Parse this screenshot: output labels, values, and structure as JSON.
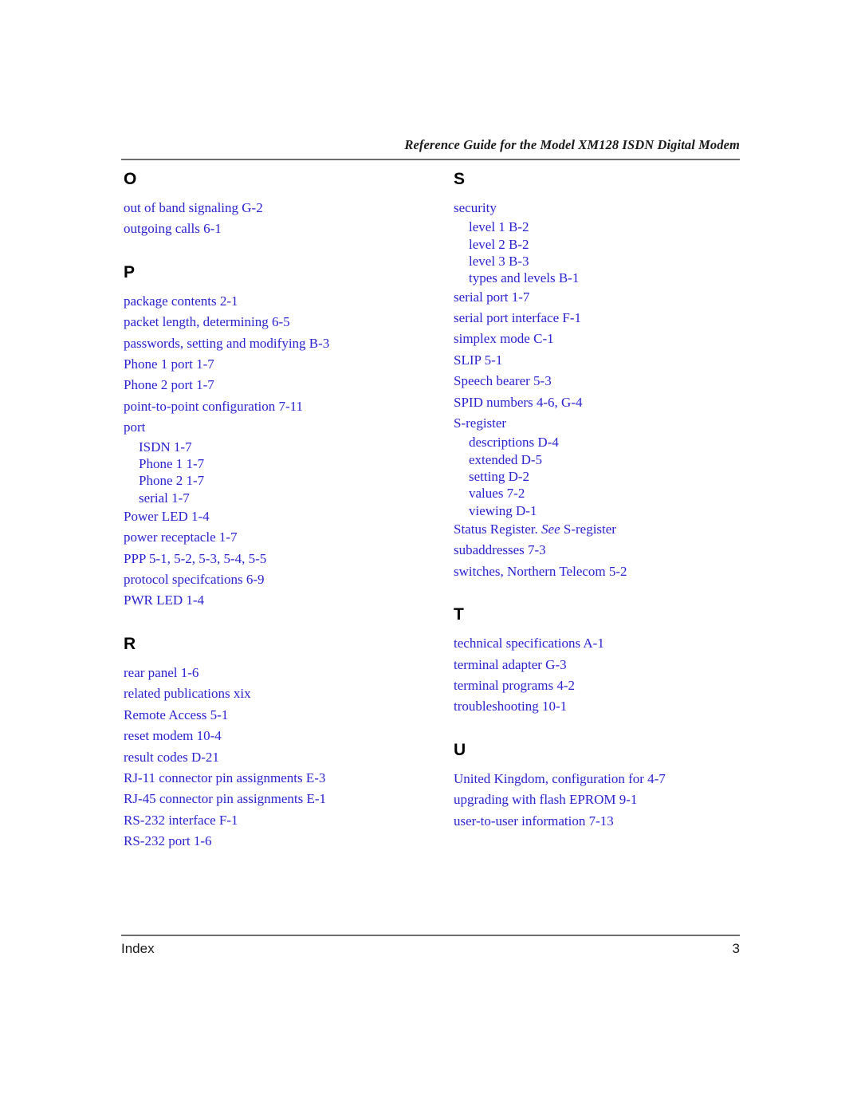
{
  "header": {
    "title": "Reference Guide for the Model XM128 ISDN Digital Modem"
  },
  "footer": {
    "label": "Index",
    "page_number": "3"
  },
  "colors": {
    "entry_blue": "#2a23cf",
    "heading_black": "#000000",
    "rule_gray": "#6e6e6e"
  },
  "columns": [
    {
      "name": "left-column",
      "sections": [
        {
          "letter": "O",
          "entries": [
            {
              "text": "out of band signaling  G-2",
              "level": "main"
            },
            {
              "text": "outgoing calls  6-1",
              "level": "main"
            }
          ]
        },
        {
          "letter": "P",
          "entries": [
            {
              "text": "package contents  2-1",
              "level": "main"
            },
            {
              "text": "packet length, determining  6-5",
              "level": "main"
            },
            {
              "text": "passwords, setting and modifying  B-3",
              "level": "main"
            },
            {
              "text": "Phone 1 port  1-7",
              "level": "main"
            },
            {
              "text": "Phone 2 port  1-7",
              "level": "main"
            },
            {
              "text": "point-to-point configuration  7-11",
              "level": "main"
            },
            {
              "text": "port",
              "level": "main"
            },
            {
              "text": "ISDN  1-7",
              "level": "sub"
            },
            {
              "text": "Phone 1  1-7",
              "level": "sub"
            },
            {
              "text": "Phone 2  1-7",
              "level": "sub"
            },
            {
              "text": "serial  1-7",
              "level": "sub"
            },
            {
              "text": "Power LED  1-4",
              "level": "main"
            },
            {
              "text": "power receptacle  1-7",
              "level": "main"
            },
            {
              "text": "PPP  5-1, 5-2, 5-3, 5-4, 5-5",
              "level": "main"
            },
            {
              "text": "protocol specifcations  6-9",
              "level": "main"
            },
            {
              "text": "PWR LED  1-4",
              "level": "main"
            }
          ]
        },
        {
          "letter": "R",
          "entries": [
            {
              "text": "rear panel  1-6",
              "level": "main"
            },
            {
              "text": "related publications  xix",
              "level": "main"
            },
            {
              "text": "Remote Access  5-1",
              "level": "main"
            },
            {
              "text": "reset modem  10-4",
              "level": "main"
            },
            {
              "text": "result codes  D-21",
              "level": "main"
            },
            {
              "text": "RJ-11 connector pin assignments  E-3",
              "level": "main"
            },
            {
              "text": "RJ-45 connector pin assignments  E-1",
              "level": "main"
            },
            {
              "text": "RS-232 interface  F-1",
              "level": "main"
            },
            {
              "text": "RS-232 port  1-6",
              "level": "main"
            }
          ]
        }
      ]
    },
    {
      "name": "right-column",
      "sections": [
        {
          "letter": "S",
          "entries": [
            {
              "text": "security",
              "level": "main"
            },
            {
              "text": "level 1  B-2",
              "level": "sub"
            },
            {
              "text": "level 2  B-2",
              "level": "sub"
            },
            {
              "text": "level 3  B-3",
              "level": "sub"
            },
            {
              "text": "types and levels  B-1",
              "level": "sub"
            },
            {
              "text": "serial port  1-7",
              "level": "main"
            },
            {
              "text": "serial port interface  F-1",
              "level": "main"
            },
            {
              "text": "simplex mode  C-1",
              "level": "main"
            },
            {
              "text": "SLIP  5-1",
              "level": "main"
            },
            {
              "text": "Speech bearer  5-3",
              "level": "main"
            },
            {
              "text": "SPID numbers  4-6, G-4",
              "level": "main"
            },
            {
              "text": "S-register",
              "level": "main"
            },
            {
              "text": "descriptions  D-4",
              "level": "sub"
            },
            {
              "text": "extended  D-5",
              "level": "sub"
            },
            {
              "text": "setting  D-2",
              "level": "sub"
            },
            {
              "text": "values  7-2",
              "level": "sub"
            },
            {
              "text": "viewing  D-1",
              "level": "sub"
            },
            {
              "text": "Status Register. ",
              "italic": "See",
              "text_after": "  S-register",
              "level": "main"
            },
            {
              "text": "subaddresses  7-3",
              "level": "main"
            },
            {
              "text": "switches, Northern Telecom  5-2",
              "level": "main"
            }
          ]
        },
        {
          "letter": "T",
          "entries": [
            {
              "text": "technical specifications  A-1",
              "level": "main"
            },
            {
              "text": "terminal adapter  G-3",
              "level": "main"
            },
            {
              "text": "terminal programs  4-2",
              "level": "main"
            },
            {
              "text": "troubleshooting  10-1",
              "level": "main"
            }
          ]
        },
        {
          "letter": "U",
          "entries": [
            {
              "text": "United Kingdom, configuration for  4-7",
              "level": "main"
            },
            {
              "text": "upgrading with flash EPROM  9-1",
              "level": "main"
            },
            {
              "text": "user-to-user information  7-13",
              "level": "main"
            }
          ]
        }
      ]
    }
  ]
}
